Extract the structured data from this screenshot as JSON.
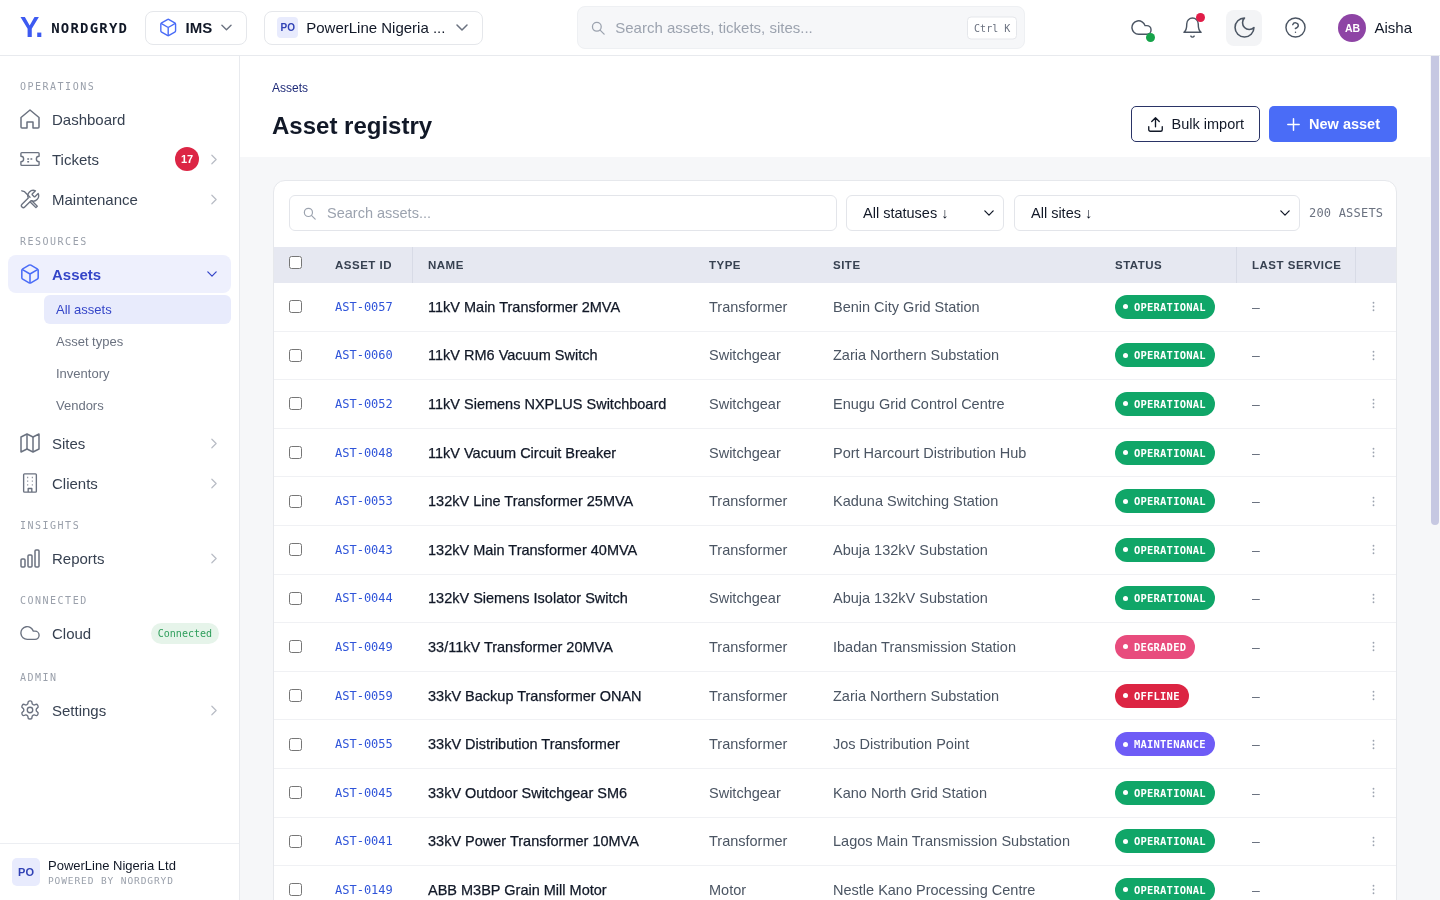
{
  "topbar": {
    "brand": {
      "mark": "Y.",
      "name": "NORDGRYD"
    },
    "product_switcher": {
      "label": "IMS"
    },
    "org_switcher": {
      "initials": "PO",
      "label": "PowerLine Nigeria ..."
    },
    "search": {
      "placeholder": "Search assets, tickets, sites...",
      "shortcut": "Ctrl K"
    },
    "cloud": {
      "connected": true
    },
    "notifications": {
      "unread": true
    },
    "user": {
      "initials": "AB",
      "name": "Aisha"
    }
  },
  "sidebar": {
    "sections": [
      {
        "label": "OPERATIONS",
        "items": [
          {
            "label": "Dashboard",
            "selected": false
          },
          {
            "label": "Tickets",
            "selected": false,
            "count": "17",
            "expanded": false
          },
          {
            "label": "Maintenance",
            "selected": false,
            "expanded": false
          }
        ]
      },
      {
        "label": "RESOURCES",
        "items": [
          {
            "label": "Assets",
            "selected": true,
            "expanded": true,
            "children": [
              {
                "label": "All assets",
                "selected": true
              },
              {
                "label": "Asset types",
                "selected": false
              },
              {
                "label": "Inventory",
                "selected": false
              },
              {
                "label": "Vendors",
                "selected": false
              }
            ]
          },
          {
            "label": "Sites",
            "selected": false,
            "expanded": false
          },
          {
            "label": "Clients",
            "selected": false,
            "expanded": false
          }
        ]
      },
      {
        "label": "INSIGHTS",
        "items": [
          {
            "label": "Reports",
            "selected": false,
            "expanded": false
          }
        ]
      },
      {
        "label": "CONNECTED",
        "items": [
          {
            "label": "Cloud",
            "selected": false,
            "status": "Connected"
          }
        ]
      },
      {
        "label": "ADMIN",
        "items": [
          {
            "label": "Settings",
            "selected": false,
            "expanded": false
          }
        ]
      }
    ],
    "footer": {
      "initials": "PO",
      "org": "PowerLine Nigeria Ltd",
      "tagline": "POWERED BY NORDGRYD"
    }
  },
  "page": {
    "breadcrumb": "Assets",
    "title": "Asset registry",
    "actions": [
      {
        "label": "Bulk import",
        "kind": "secondary"
      },
      {
        "label": "New asset",
        "kind": "primary"
      }
    ]
  },
  "toolbar": {
    "search": {
      "placeholder": "Search assets..."
    },
    "filters": [
      {
        "label": "All statuses ↓"
      },
      {
        "label": "All sites ↓"
      }
    ],
    "count": "200 ASSETS"
  },
  "table": {
    "select_all": {
      "checked": false
    },
    "columns": [
      "ASSET ID",
      "NAME",
      "TYPE",
      "SITE",
      "STATUS",
      "LAST SERVICE"
    ],
    "rows": [
      {
        "checked": false,
        "asset_id": "AST-0057",
        "name": "11kV Main Transformer 2MVA",
        "type": "Transformer",
        "site": "Benin City Grid Station",
        "status": {
          "label": "OPERATIONAL",
          "color": "#10a668"
        },
        "last_service": "–"
      },
      {
        "checked": false,
        "asset_id": "AST-0060",
        "name": "11kV RM6 Vacuum Switch",
        "type": "Switchgear",
        "site": "Zaria Northern Substation",
        "status": {
          "label": "OPERATIONAL",
          "color": "#10a668"
        },
        "last_service": "–"
      },
      {
        "checked": false,
        "asset_id": "AST-0052",
        "name": "11kV Siemens NXPLUS Switchboard",
        "type": "Switchgear",
        "site": "Enugu Grid Control Centre",
        "status": {
          "label": "OPERATIONAL",
          "color": "#10a668"
        },
        "last_service": "–"
      },
      {
        "checked": false,
        "asset_id": "AST-0048",
        "name": "11kV Vacuum Circuit Breaker",
        "type": "Switchgear",
        "site": "Port Harcourt Distribution Hub",
        "status": {
          "label": "OPERATIONAL",
          "color": "#10a668"
        },
        "last_service": "–"
      },
      {
        "checked": false,
        "asset_id": "AST-0053",
        "name": "132kV Line Transformer 25MVA",
        "type": "Transformer",
        "site": "Kaduna Switching Station",
        "status": {
          "label": "OPERATIONAL",
          "color": "#10a668"
        },
        "last_service": "–"
      },
      {
        "checked": false,
        "asset_id": "AST-0043",
        "name": "132kV Main Transformer 40MVA",
        "type": "Transformer",
        "site": "Abuja 132kV Substation",
        "status": {
          "label": "OPERATIONAL",
          "color": "#10a668"
        },
        "last_service": "–"
      },
      {
        "checked": false,
        "asset_id": "AST-0044",
        "name": "132kV Siemens Isolator Switch",
        "type": "Switchgear",
        "site": "Abuja 132kV Substation",
        "status": {
          "label": "OPERATIONAL",
          "color": "#10a668"
        },
        "last_service": "–"
      },
      {
        "checked": false,
        "asset_id": "AST-0049",
        "name": "33/11kV Transformer 20MVA",
        "type": "Transformer",
        "site": "Ibadan Transmission Station",
        "status": {
          "label": "DEGRADED",
          "color": "#e84c7d"
        },
        "last_service": "–"
      },
      {
        "checked": false,
        "asset_id": "AST-0059",
        "name": "33kV Backup Transformer ONAN",
        "type": "Transformer",
        "site": "Zaria Northern Substation",
        "status": {
          "label": "OFFLINE",
          "color": "#dc2543"
        },
        "last_service": "–"
      },
      {
        "checked": false,
        "asset_id": "AST-0055",
        "name": "33kV Distribution Transformer",
        "type": "Transformer",
        "site": "Jos Distribution Point",
        "status": {
          "label": "MAINTENANCE",
          "color": "#6e5cf6"
        },
        "last_service": "–"
      },
      {
        "checked": false,
        "asset_id": "AST-0045",
        "name": "33kV Outdoor Switchgear SM6",
        "type": "Switchgear",
        "site": "Kano North Grid Station",
        "status": {
          "label": "OPERATIONAL",
          "color": "#10a668"
        },
        "last_service": "–"
      },
      {
        "checked": false,
        "asset_id": "AST-0041",
        "name": "33kV Power Transformer 10MVA",
        "type": "Transformer",
        "site": "Lagos Main Transmission Substation",
        "status": {
          "label": "OPERATIONAL",
          "color": "#10a668"
        },
        "last_service": "–"
      },
      {
        "checked": false,
        "asset_id": "AST-0149",
        "name": "ABB M3BP Grain Mill Motor",
        "type": "Motor",
        "site": "Nestle Kano Processing Centre",
        "status": {
          "label": "OPERATIONAL",
          "color": "#10a668"
        },
        "last_service": "–"
      }
    ]
  }
}
